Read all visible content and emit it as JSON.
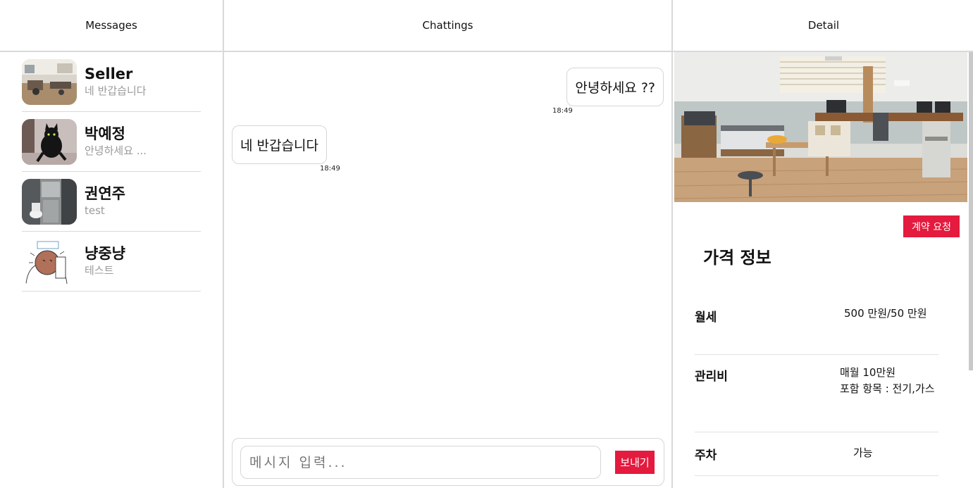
{
  "messages_pane": {
    "title": "Messages",
    "conversations": [
      {
        "name": "Seller",
        "preview": "네 반갑습니다"
      },
      {
        "name": "박예정",
        "preview": "안녕하세요 ..."
      },
      {
        "name": "권연주",
        "preview": "test"
      },
      {
        "name": "냥중냥",
        "preview": "테스트"
      }
    ]
  },
  "chat_pane": {
    "title": "Chattings",
    "messages": [
      {
        "direction": "outgoing",
        "text": "안녕하세요 ??",
        "time": "18:49"
      },
      {
        "direction": "incoming",
        "text": "네 반갑습니다",
        "time": "18:49"
      }
    ],
    "composer": {
      "placeholder": "메시지 입력...",
      "value": "",
      "send_label": "보내기"
    }
  },
  "detail_pane": {
    "title": "Detail",
    "contract_button_label": "계약 요청",
    "section_title": "가격 정보",
    "rows": [
      {
        "label": "월세",
        "value": "500 만원/50 만원"
      },
      {
        "label": "관리비",
        "value": "매월 10만원",
        "value_line2": "포함 항목 : 전기,가스"
      },
      {
        "label": "주차",
        "value": "가능"
      }
    ]
  },
  "colors": {
    "accent": "#e41a3e",
    "divider": "#d9d9d9",
    "muted_text": "#9a9a9a"
  }
}
